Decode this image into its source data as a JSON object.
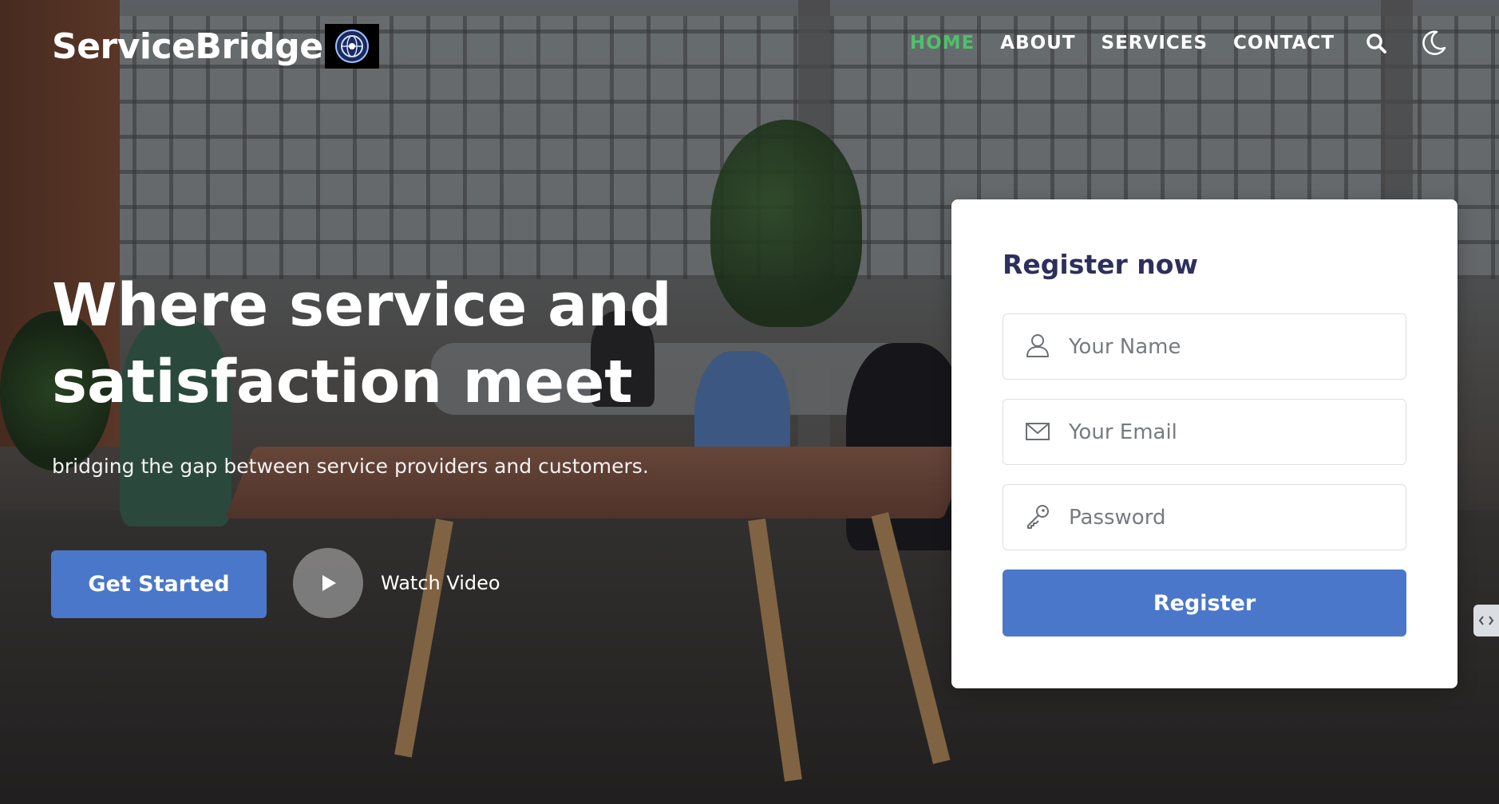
{
  "brand": {
    "name": "ServiceBridge",
    "badge_icon": "globe-icon"
  },
  "nav": {
    "items": [
      {
        "label": "HOME",
        "active": true
      },
      {
        "label": "ABOUT",
        "active": false
      },
      {
        "label": "SERVICES",
        "active": false
      },
      {
        "label": "CONTACT",
        "active": false
      }
    ],
    "search_icon": "search-icon",
    "theme_icon": "moon-icon",
    "active_color": "#4fc06b"
  },
  "hero": {
    "title_line1": "Where service and",
    "title_line2": "satisfaction meet",
    "subtitle": "bridging the gap between service providers and customers.",
    "cta_label": "Get Started",
    "video_label": "Watch Video"
  },
  "register": {
    "title": "Register now",
    "name_placeholder": "Your Name",
    "email_placeholder": "Your Email",
    "password_placeholder": "Password",
    "submit_label": "Register"
  },
  "colors": {
    "primary": "#4a77c9",
    "heading": "#2e2f5c"
  }
}
